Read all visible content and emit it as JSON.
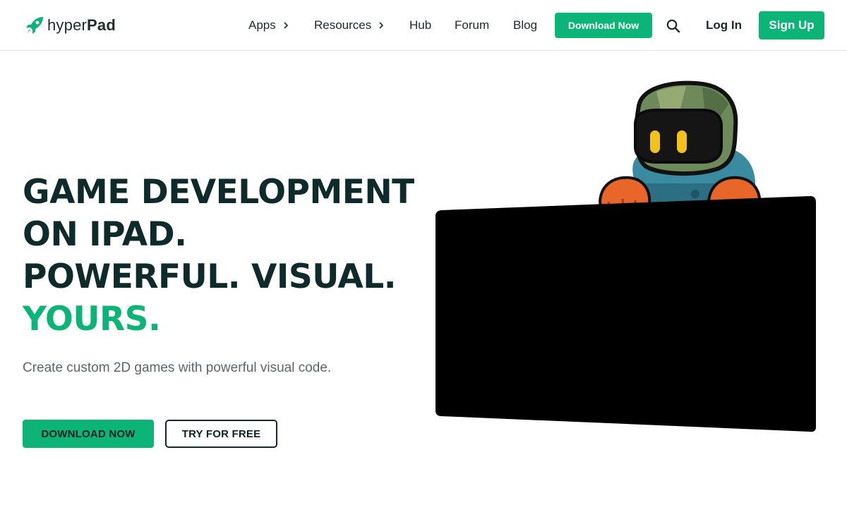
{
  "brand": {
    "name_light": "hyper",
    "name_bold": "Pad",
    "accent_color": "#0db477",
    "logo_icon": "rocket-icon"
  },
  "nav": {
    "items": [
      {
        "label": "Apps",
        "has_submenu": true
      },
      {
        "label": "Resources",
        "has_submenu": true
      },
      {
        "label": "Hub",
        "has_submenu": false
      },
      {
        "label": "Forum",
        "has_submenu": false
      },
      {
        "label": "Blog",
        "has_submenu": false
      }
    ],
    "download_label": "Download Now",
    "search_icon": "search-icon",
    "login_label": "Log In",
    "signup_label": "Sign Up"
  },
  "hero": {
    "title_lines": [
      "GAME DEVELOPMENT",
      "ON IPAD.",
      "POWERFUL. VISUAL."
    ],
    "title_accent": "YOURS.",
    "subtitle": "Create custom 2D games with powerful visual code.",
    "primary_cta": "DOWNLOAD NOW",
    "secondary_cta": "TRY FOR FREE",
    "illustration": "robot-mascot-holding-screen"
  }
}
